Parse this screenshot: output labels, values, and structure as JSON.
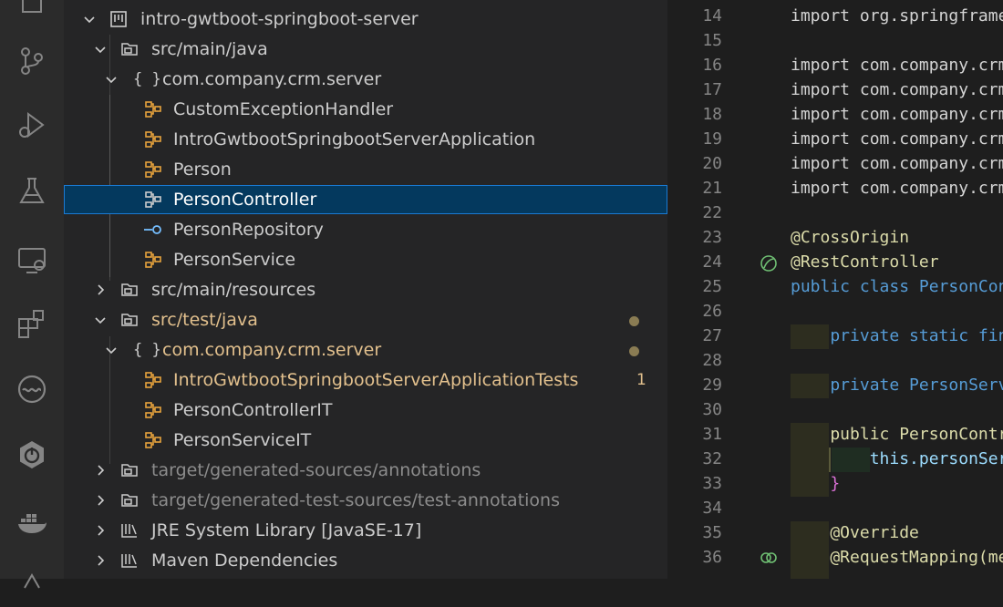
{
  "activity_bar": {
    "icons": [
      "explorer-icon",
      "source-control-icon",
      "run-debug-icon",
      "testing-icon",
      "remote-explorer-icon",
      "extensions-icon",
      "gitlens-icon",
      "spring-boot-icon",
      "docker-icon"
    ]
  },
  "explorer": {
    "rows": [
      {
        "label": "intro-gwtboot-springboot-server"
      },
      {
        "label": "src/main/java"
      },
      {
        "label": "com.company.crm.server"
      },
      {
        "label": "CustomExceptionHandler"
      },
      {
        "label": "IntroGwtbootSpringbootServerApplication"
      },
      {
        "label": "Person"
      },
      {
        "label": "PersonController"
      },
      {
        "label": "PersonRepository"
      },
      {
        "label": "PersonService"
      },
      {
        "label": "src/main/resources"
      },
      {
        "label": "src/test/java"
      },
      {
        "label": "com.company.crm.server"
      },
      {
        "label": "IntroGwtbootSpringbootServerApplicationTests",
        "badge": "1"
      },
      {
        "label": "PersonControllerIT"
      },
      {
        "label": "PersonServiceIT"
      },
      {
        "label": "target/generated-sources/annotations"
      },
      {
        "label": "target/generated-test-sources/test-annotations"
      },
      {
        "label": "JRE System Library [JavaSE-17]"
      },
      {
        "label": "Maven Dependencies"
      }
    ],
    "colors": {
      "selected_bg": "#04395e",
      "selected_border": "#1a7ad3",
      "modified": "#e2c08d",
      "class_icon": "#e8a33d",
      "interface_icon": "#75beff"
    }
  },
  "editor": {
    "lines": [
      {
        "n": "14",
        "t": "import org.springframe"
      },
      {
        "n": "15",
        "t": ""
      },
      {
        "n": "16",
        "t": "import com.company.crm"
      },
      {
        "n": "17",
        "t": "import com.company.crm"
      },
      {
        "n": "18",
        "t": "import com.company.crm"
      },
      {
        "n": "19",
        "t": "import com.company.crm"
      },
      {
        "n": "20",
        "t": "import com.company.crm"
      },
      {
        "n": "21",
        "t": "import com.company.crm"
      },
      {
        "n": "22",
        "t": ""
      },
      {
        "n": "23",
        "t": "@CrossOrigin"
      },
      {
        "n": "24",
        "t": "@RestController"
      },
      {
        "n": "25",
        "t": "public class PersonCon"
      },
      {
        "n": "26",
        "t": ""
      },
      {
        "n": "27",
        "t": "    private static fin"
      },
      {
        "n": "28",
        "t": ""
      },
      {
        "n": "29",
        "t": "    private PersonServ"
      },
      {
        "n": "30",
        "t": ""
      },
      {
        "n": "31",
        "t": "    public PersonContr"
      },
      {
        "n": "32",
        "t": "        this.personSer"
      },
      {
        "n": "33",
        "t": "    }"
      },
      {
        "n": "34",
        "t": ""
      },
      {
        "n": "35",
        "t": "    @Override"
      },
      {
        "n": "36",
        "t": "    @RequestMapping(me"
      }
    ]
  }
}
